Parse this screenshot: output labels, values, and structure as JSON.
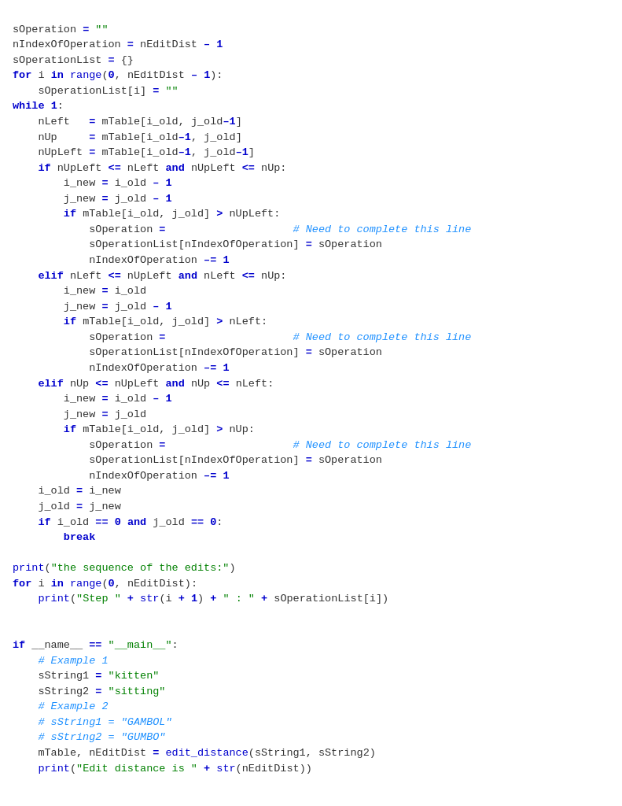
{
  "code": {
    "lines": [
      "sOperation = \"\"",
      "nIndexOfOperation = nEditDist – 1",
      "sOperationList = {}",
      "for i in range(0, nEditDist – 1):",
      "    sOperationList[i] = \"\"",
      "while 1:",
      "    nLeft   = mTable[i_old, j_old–1]",
      "    nUp     = mTable[i_old–1, j_old]",
      "    nUpLeft = mTable[i_old–1, j_old–1]",
      "    if nUpLeft <= nLeft and nUpLeft <= nUp:",
      "        i_new = i_old – 1",
      "        j_new = j_old – 1",
      "        if mTable[i_old, j_old] > nUpLeft:",
      "            sOperation =                    # Need to complete this line",
      "            sOperationList[nIndexOfOperation] = sOperation",
      "            nIndexOfOperation –= 1",
      "    elif nLeft <= nUpLeft and nLeft <= nUp:",
      "        i_new = i_old",
      "        j_new = j_old – 1",
      "        if mTable[i_old, j_old] > nLeft:",
      "            sOperation =                    # Need to complete this line",
      "            sOperationList[nIndexOfOperation] = sOperation",
      "            nIndexOfOperation –= 1",
      "    elif nUp <= nUpLeft and nUp <= nLeft:",
      "        i_new = i_old – 1",
      "        j_new = j_old",
      "        if mTable[i_old, j_old] > nUp:",
      "            sOperation =                    # Need to complete this line",
      "            sOperationList[nIndexOfOperation] = sOperation",
      "            nIndexOfOperation –= 1",
      "    i_old = i_new",
      "    j_old = j_new",
      "    if i_old == 0 and j_old == 0:",
      "        break",
      "",
      "print(\"the sequence of the edits:\")",
      "for i in range(0, nEditDist):",
      "    print(\"Step \" + str(i + 1) + \" : \" + sOperationList[i])",
      "",
      "",
      "if __name__ == \"__main__\":",
      "    # Example 1",
      "    sString1 = \"kitten\"",
      "    sString2 = \"sitting\"",
      "    # Example 2",
      "    # sString1 = \"GAMBOL\"",
      "    # sString2 = \"GUMBO\"",
      "    mTable, nEditDist = edit_distance(sString1, sString2)",
      "    print(\"Edit distance is \" + str(nEditDist))"
    ]
  }
}
